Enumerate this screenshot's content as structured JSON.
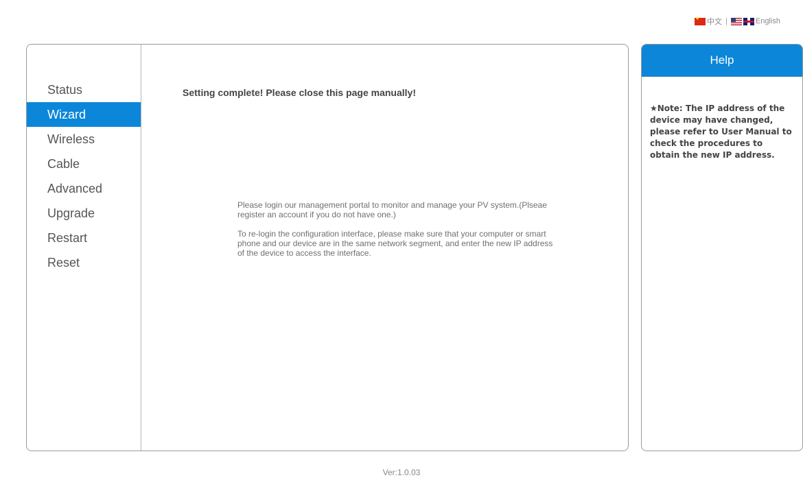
{
  "language_bar": {
    "chinese_label": "中文",
    "separator": "|",
    "english_label": "English"
  },
  "sidebar": {
    "items": [
      {
        "label": "Status",
        "active": false
      },
      {
        "label": "Wizard",
        "active": true
      },
      {
        "label": "Wireless",
        "active": false
      },
      {
        "label": "Cable",
        "active": false
      },
      {
        "label": "Advanced",
        "active": false
      },
      {
        "label": "Upgrade",
        "active": false
      },
      {
        "label": "Restart",
        "active": false
      },
      {
        "label": "Reset",
        "active": false
      }
    ]
  },
  "main": {
    "complete_message": "Setting complete! Please close this page manually!",
    "info_paragraph_1": "Please login our management portal to monitor and manage your PV system.(Plseae register an account if you do not have one.)",
    "info_paragraph_2": "To re-login the configuration interface, please make sure that your computer or smart phone and our device are in the same network segment, and enter the new IP address of the device to access the interface."
  },
  "help": {
    "title": "Help",
    "note_icon": "★",
    "note": "Note: The IP address of the device may have changed, please refer to User Manual to check the procedures to obtain the new IP address."
  },
  "footer": {
    "version": "Ver:1.0.03"
  },
  "colors": {
    "accent": "#0c86d8",
    "border": "#9a9a9a"
  }
}
